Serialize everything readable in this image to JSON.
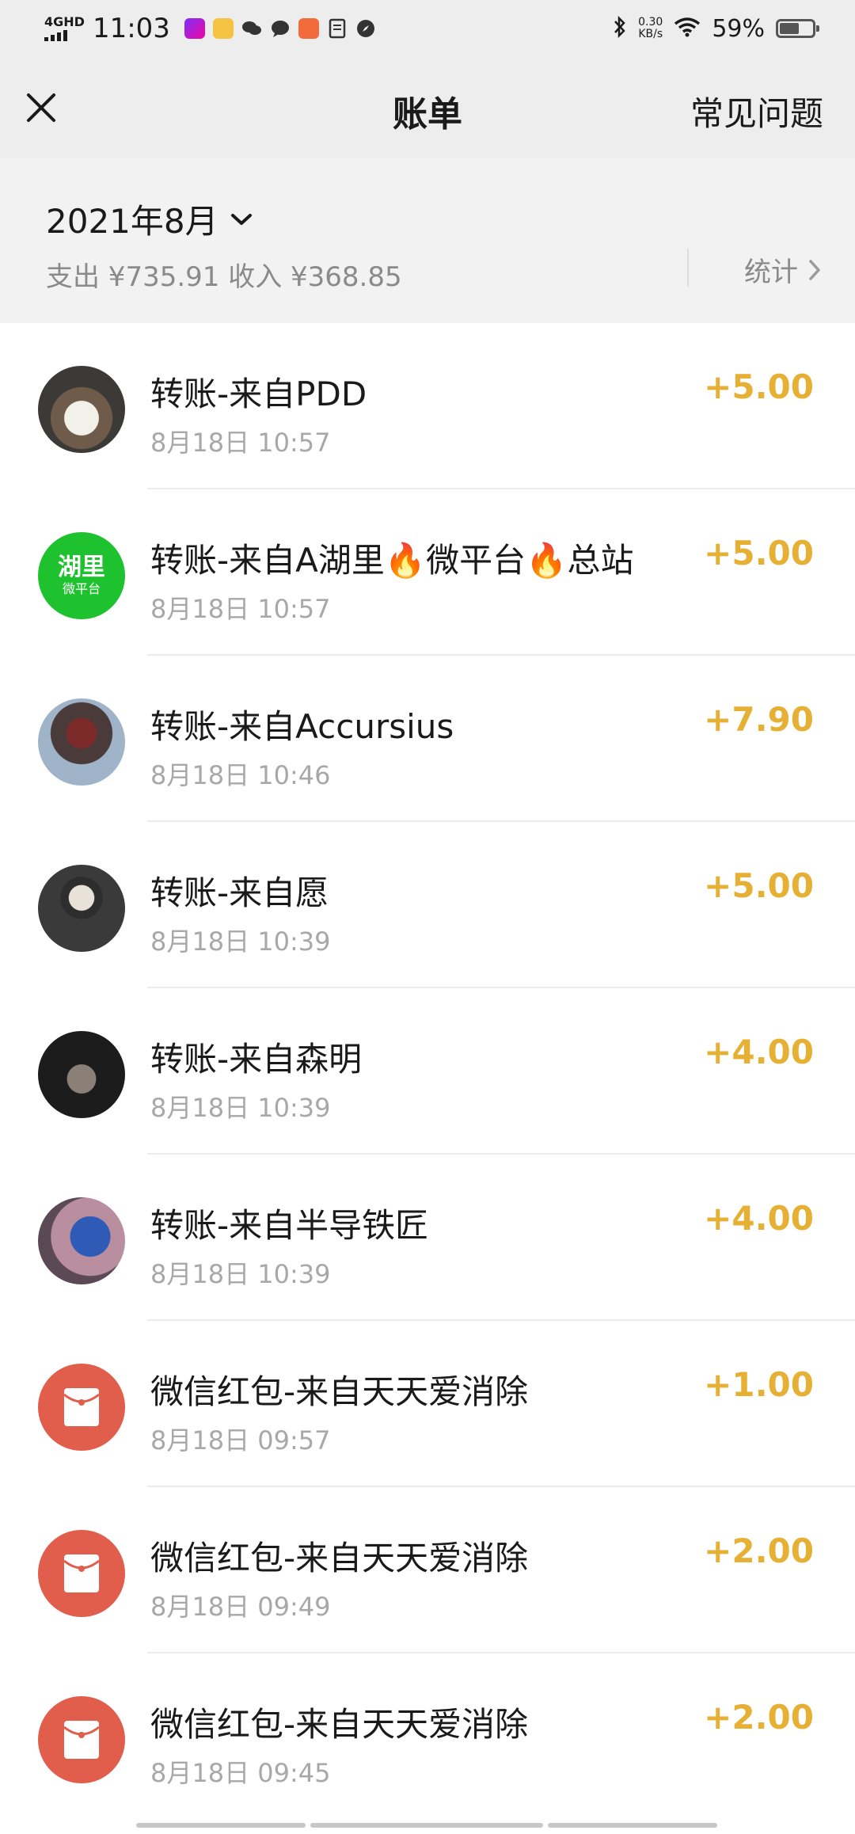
{
  "status_bar": {
    "network": "4GHD",
    "time": "11:03",
    "speed_value": "0.30",
    "speed_unit": "KB/s",
    "battery_pct": "59%",
    "battery_level": 0.59
  },
  "nav": {
    "title": "账单",
    "faq": "常见问题"
  },
  "summary": {
    "month": "2021年8月",
    "totals": "支出 ¥735.91 收入 ¥368.85",
    "stats": "统计"
  },
  "transactions": [
    {
      "title": "转账-来自PDD",
      "time": "8月18日 10:57",
      "amount": "+5.00",
      "avatar": "photo-avatar"
    },
    {
      "title": "转账-来自A湖里🔥微平台🔥总站",
      "time": "8月18日 10:57",
      "amount": "+5.00",
      "avatar": "logo-avatar",
      "avatar_text_main": "湖里",
      "avatar_text_sub": "微平台"
    },
    {
      "title": "转账-来自Accursius",
      "time": "8月18日 10:46",
      "amount": "+7.90",
      "avatar": "photo-avatar"
    },
    {
      "title": "转账-来自愿",
      "time": "8月18日 10:39",
      "amount": "+5.00",
      "avatar": "photo-avatar"
    },
    {
      "title": "转账-来自森明",
      "time": "8月18日 10:39",
      "amount": "+4.00",
      "avatar": "photo-avatar"
    },
    {
      "title": "转账-来自半导铁匠",
      "time": "8月18日 10:39",
      "amount": "+4.00",
      "avatar": "photo-avatar"
    },
    {
      "title": "微信红包-来自天天爱消除",
      "time": "8月18日 09:57",
      "amount": "+1.00",
      "avatar": "red-packet-icon"
    },
    {
      "title": "微信红包-来自天天爱消除",
      "time": "8月18日 09:49",
      "amount": "+2.00",
      "avatar": "red-packet-icon"
    },
    {
      "title": "微信红包-来自天天爱消除",
      "time": "8月18日 09:45",
      "amount": "+2.00",
      "avatar": "red-packet-icon"
    }
  ],
  "colors": {
    "amount": "#e6b035",
    "red_packet": "#e15d4c",
    "header_bg": "#ededed"
  }
}
